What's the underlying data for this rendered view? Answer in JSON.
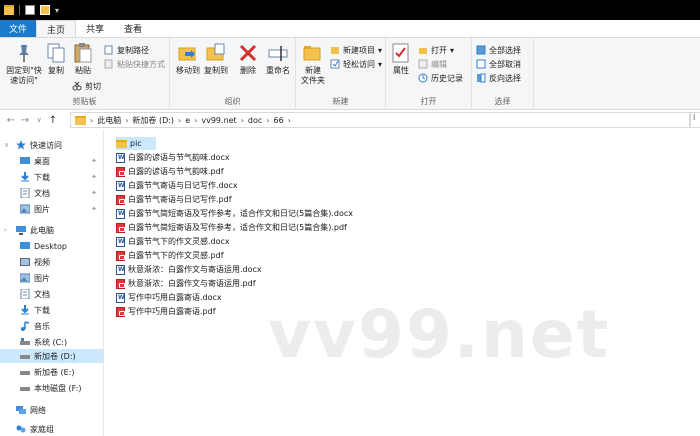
{
  "ribbon": {
    "tabs": [
      "文件",
      "主页",
      "共享",
      "查看"
    ],
    "groups": {
      "clipboard": {
        "label": "剪贴板",
        "pin_quick_access": "固定到\"快\n速访问\"",
        "copy": "复制",
        "paste": "粘贴",
        "copy_path": "复制路径",
        "paste_shortcut": "粘贴快捷方式",
        "cut": "剪切"
      },
      "organize": {
        "label": "组织",
        "move_to": "移动到",
        "copy_to": "复制到",
        "delete": "删除",
        "rename": "重命名"
      },
      "new": {
        "label": "新建",
        "new_folder": "新建\n文件夹",
        "new_item": "新建项目",
        "easy_access": "轻松访问"
      },
      "open": {
        "label": "打开",
        "properties": "属性",
        "open": "打开",
        "edit": "编辑",
        "history": "历史记录"
      },
      "select": {
        "label": "选择",
        "select_all": "全部选择",
        "select_none": "全部取消",
        "invert": "反向选择"
      }
    }
  },
  "address": {
    "crumbs": [
      "此电脑",
      "新加卷 (D:)",
      "e",
      "vv99.net",
      "doc",
      "66"
    ],
    "search_partial": "I"
  },
  "nav": {
    "items": [
      {
        "label": "快速访问",
        "icon": "star-icon"
      },
      {
        "label": "桌面",
        "icon": "desktop-icon"
      },
      {
        "label": "下载",
        "icon": "download-icon"
      },
      {
        "label": "文档",
        "icon": "documents-icon"
      },
      {
        "label": "图片",
        "icon": "pictures-icon"
      },
      {
        "label": "此电脑",
        "icon": "computer-icon"
      },
      {
        "label": "Desktop",
        "icon": "desktop-icon"
      },
      {
        "label": "视频",
        "icon": "videos-icon"
      },
      {
        "label": "图片",
        "icon": "pictures-icon"
      },
      {
        "label": "文档",
        "icon": "documents-icon"
      },
      {
        "label": "下载",
        "icon": "download-icon"
      },
      {
        "label": "音乐",
        "icon": "music-icon"
      },
      {
        "label": "系统 (C:)",
        "icon": "drive-icon"
      },
      {
        "label": "新加卷 (D:)",
        "icon": "drive-icon"
      },
      {
        "label": "新加卷 (E:)",
        "icon": "drive-icon"
      },
      {
        "label": "本地磁盘 (F:)",
        "icon": "drive-icon"
      },
      {
        "label": "网络",
        "icon": "network-icon"
      },
      {
        "label": "家庭组",
        "icon": "homegroup-icon"
      }
    ]
  },
  "files": [
    {
      "name": "pic",
      "type": "folder"
    },
    {
      "name": "白露的谚语与节气韵味.docx",
      "type": "docx"
    },
    {
      "name": "白露的谚语与节气韵味.pdf",
      "type": "pdf"
    },
    {
      "name": "白露节气寄语与日记写作.docx",
      "type": "docx"
    },
    {
      "name": "白露节气寄语与日记写作.pdf",
      "type": "pdf"
    },
    {
      "name": "白露节气简短寄语及写作参考，适合作文和日记(5篇合集).docx",
      "type": "docx"
    },
    {
      "name": "白露节气简短寄语及写作参考，适合作文和日记(5篇合集).pdf",
      "type": "pdf"
    },
    {
      "name": "白露节气下的作文灵感.docx",
      "type": "docx"
    },
    {
      "name": "白露节气下的作文灵感.pdf",
      "type": "pdf"
    },
    {
      "name": "秋意渐浓：白露作文与寄语运用.docx",
      "type": "docx"
    },
    {
      "name": "秋意渐浓：白露作文与寄语运用.pdf",
      "type": "pdf"
    },
    {
      "name": "写作中巧用白露寄语.docx",
      "type": "docx"
    },
    {
      "name": "写作中巧用白露寄语.pdf",
      "type": "pdf"
    }
  ],
  "watermark": "vv99.net"
}
